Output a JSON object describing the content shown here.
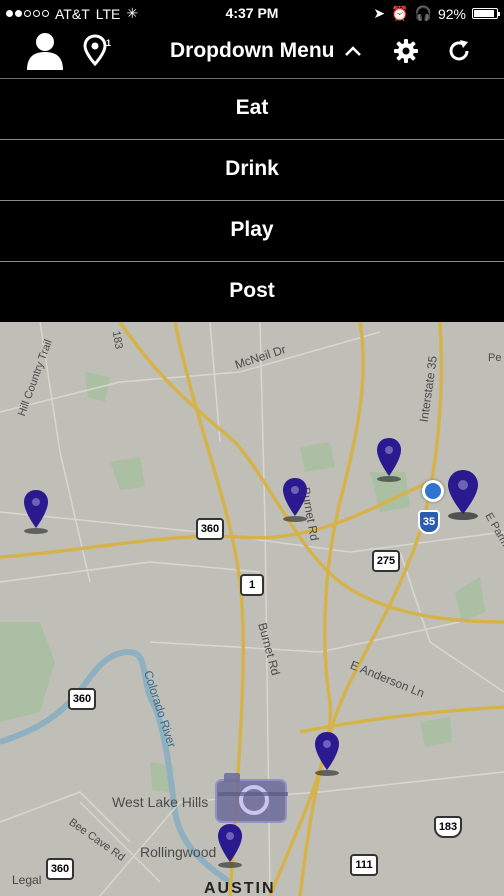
{
  "status_bar": {
    "carrier": "AT&T",
    "network": "LTE",
    "time": "4:37 PM",
    "battery": "92%",
    "battery_level": 0.92
  },
  "nav": {
    "title": "Dropdown Menu",
    "icons": [
      "profile-icon",
      "location-pin-icon",
      "chevron-up-icon",
      "gear-icon",
      "refresh-icon"
    ]
  },
  "menu": {
    "items": [
      {
        "label": "Eat"
      },
      {
        "label": "Drink"
      },
      {
        "label": "Play"
      },
      {
        "label": "Post"
      }
    ]
  },
  "map": {
    "labels": {
      "mcneil": "McNeil Dr",
      "burnet1": "Burnet Rd",
      "burnet2": "Burnet Rd",
      "interstate": "Interstate 35",
      "anderson": "E Anderson Ln",
      "colorado": "Colorado River",
      "westlake": "West Lake Hills",
      "beecave": "Bee Cave Rd",
      "rollingwood": "Rollingwood",
      "austin": "AUSTIN",
      "legal": "Legal",
      "hillcountry": "Hill Country Trail",
      "hwy183": "183",
      "eparmer": "E Parmer",
      "pe": "Pe"
    },
    "shields": {
      "s360a": "360",
      "s360b": "360",
      "s360c": "360",
      "s1": "1",
      "s275": "275",
      "s35": "35",
      "s183": "183",
      "s111": "111"
    },
    "pin_color": "#2b1a8f"
  }
}
